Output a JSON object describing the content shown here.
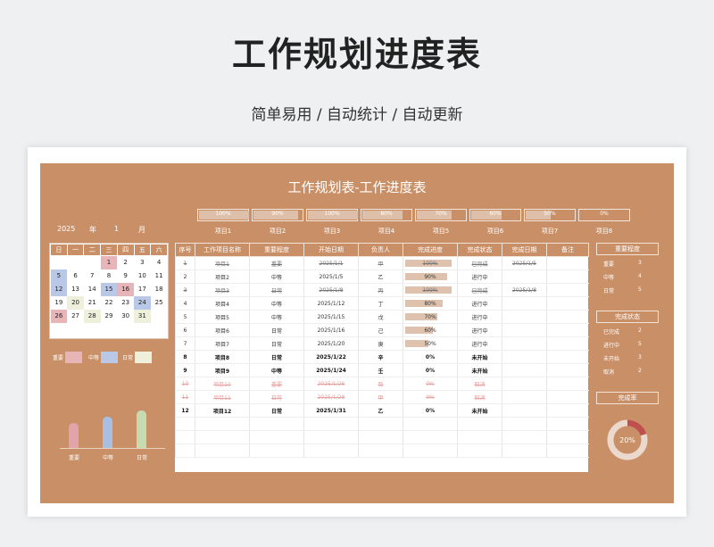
{
  "banner": {
    "title": "工作规划进度表",
    "subtitle": "简单易用  /  自动统计  /  自动更新"
  },
  "sheet": {
    "title": "工作规划表-工作进度表",
    "project_progress": [
      {
        "label": "项目1",
        "pct": "100%",
        "v": 1
      },
      {
        "label": "项目2",
        "pct": "90%",
        "v": 0.9
      },
      {
        "label": "项目3",
        "pct": "100%",
        "v": 1
      },
      {
        "label": "项目4",
        "pct": "80%",
        "v": 0.8
      },
      {
        "label": "项目5",
        "pct": "70%",
        "v": 0.7
      },
      {
        "label": "项目6",
        "pct": "60%",
        "v": 0.6
      },
      {
        "label": "项目7",
        "pct": "50%",
        "v": 0.5
      },
      {
        "label": "项目8",
        "pct": "0%",
        "v": 0
      }
    ]
  },
  "calendar": {
    "year": "2025",
    "year_unit": "年",
    "month": "1",
    "month_unit": "月",
    "weekdays": [
      "日",
      "一",
      "二",
      "三",
      "四",
      "五",
      "六"
    ],
    "weeks": [
      [
        "",
        "",
        "",
        "1",
        "2",
        "3",
        "4"
      ],
      [
        "5",
        "6",
        "7",
        "8",
        "9",
        "10",
        "11"
      ],
      [
        "12",
        "13",
        "14",
        "15",
        "16",
        "17",
        "18"
      ],
      [
        "19",
        "20",
        "21",
        "22",
        "23",
        "24",
        "25"
      ],
      [
        "26",
        "27",
        "28",
        "29",
        "30",
        "31",
        ""
      ]
    ],
    "highlight": {
      "1": "red",
      "16": "red",
      "26": "red",
      "5": "blue",
      "12": "blue",
      "15": "blue",
      "24": "blue",
      "20": "green",
      "28": "green",
      "31": "green"
    }
  },
  "legend": {
    "important": "重要",
    "medium": "中等",
    "daily": "日常",
    "colors": {
      "important": "#e7b4b8",
      "medium": "#b8c8e6",
      "daily": "#eef0dc"
    }
  },
  "chart_data": {
    "type": "bar",
    "categories": [
      "重要",
      "中等",
      "日常"
    ],
    "values": [
      3,
      4,
      5
    ],
    "colors": [
      "#e0a4aa",
      "#a9bfe2",
      "#c7dbb0"
    ]
  },
  "table": {
    "headers": [
      "序号",
      "工作项目名称",
      "重要程度",
      "开始日期",
      "负责人",
      "完成进度",
      "完成状态",
      "完成日期",
      "备注"
    ],
    "rows": [
      {
        "no": "1",
        "name": "项目1",
        "level": "重要",
        "start": "2025/1/1",
        "owner": "甲",
        "progress": "100%",
        "p": 1,
        "status": "已完成",
        "done": "2025/1/5",
        "note": "",
        "style": "done"
      },
      {
        "no": "2",
        "name": "项目2",
        "level": "中等",
        "start": "2025/1/5",
        "owner": "乙",
        "progress": "90%",
        "p": 0.9,
        "status": "进行中",
        "done": "",
        "note": "",
        "style": ""
      },
      {
        "no": "3",
        "name": "项目3",
        "level": "日常",
        "start": "2025/1/8",
        "owner": "丙",
        "progress": "100%",
        "p": 1,
        "status": "已完成",
        "done": "2025/1/8",
        "note": "",
        "style": "done"
      },
      {
        "no": "4",
        "name": "项目4",
        "level": "中等",
        "start": "2025/1/12",
        "owner": "丁",
        "progress": "80%",
        "p": 0.8,
        "status": "进行中",
        "done": "",
        "note": "",
        "style": ""
      },
      {
        "no": "5",
        "name": "项目5",
        "level": "中等",
        "start": "2025/1/15",
        "owner": "戊",
        "progress": "70%",
        "p": 0.7,
        "status": "进行中",
        "done": "",
        "note": "",
        "style": ""
      },
      {
        "no": "6",
        "name": "项目6",
        "level": "日常",
        "start": "2025/1/16",
        "owner": "己",
        "progress": "60%",
        "p": 0.6,
        "status": "进行中",
        "done": "",
        "note": "",
        "style": ""
      },
      {
        "no": "7",
        "name": "项目7",
        "level": "日常",
        "start": "2025/1/20",
        "owner": "庚",
        "progress": "50%",
        "p": 0.5,
        "status": "进行中",
        "done": "",
        "note": "",
        "style": ""
      },
      {
        "no": "8",
        "name": "项目8",
        "level": "日常",
        "start": "2025/1/22",
        "owner": "辛",
        "progress": "0%",
        "p": 0,
        "status": "未开始",
        "done": "",
        "note": "",
        "style": "nostart"
      },
      {
        "no": "9",
        "name": "项目9",
        "level": "中等",
        "start": "2025/1/24",
        "owner": "壬",
        "progress": "0%",
        "p": 0,
        "status": "未开始",
        "done": "",
        "note": "",
        "style": "nostart"
      },
      {
        "no": "10",
        "name": "项目10",
        "level": "重要",
        "start": "2025/1/26",
        "owner": "癸",
        "progress": "0%",
        "p": 0,
        "status": "取消",
        "done": "",
        "note": "",
        "style": "cancel"
      },
      {
        "no": "11",
        "name": "项目11",
        "level": "日常",
        "start": "2025/1/28",
        "owner": "甲",
        "progress": "0%",
        "p": 0,
        "status": "取消",
        "done": "",
        "note": "",
        "style": "cancel"
      },
      {
        "no": "12",
        "name": "项目12",
        "level": "日常",
        "start": "2025/1/31",
        "owner": "乙",
        "progress": "0%",
        "p": 0,
        "status": "未开始",
        "done": "",
        "note": "",
        "style": "nostart"
      }
    ]
  },
  "summary": {
    "importance": {
      "title": "重要程度",
      "items": [
        {
          "label": "重要",
          "value": "3"
        },
        {
          "label": "中等",
          "value": "4"
        },
        {
          "label": "日常",
          "value": "5"
        }
      ]
    },
    "status": {
      "title": "完成状态",
      "items": [
        {
          "label": "已完成",
          "value": "2"
        },
        {
          "label": "进行中",
          "value": "5"
        },
        {
          "label": "未开始",
          "value": "3"
        },
        {
          "label": "取消",
          "value": "2"
        }
      ]
    },
    "rate": {
      "title": "完成率",
      "value": "20%",
      "fraction": 0.2,
      "colors": {
        "done": "#c0504d",
        "rest": "#ecd9ce"
      }
    }
  }
}
